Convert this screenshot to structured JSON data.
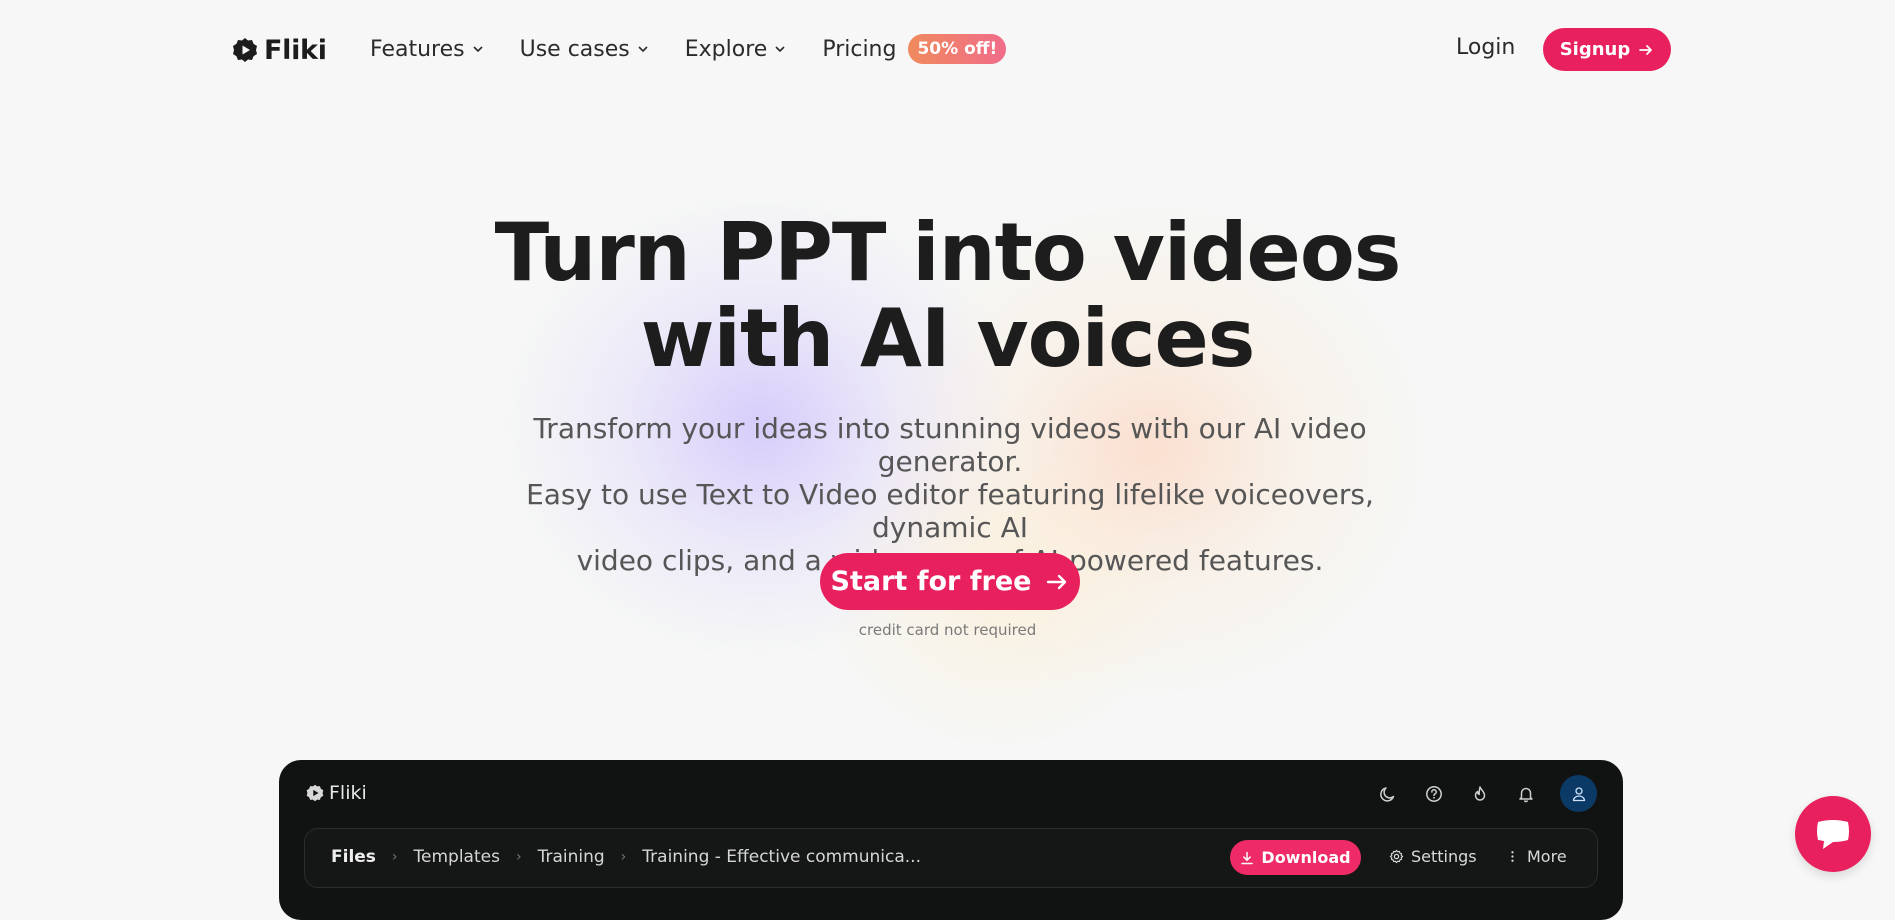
{
  "nav": {
    "logo": "Fliki",
    "items": [
      {
        "label": "Features",
        "icon": "chevron-down-icon"
      },
      {
        "label": "Use cases",
        "icon": "chevron-down-icon"
      },
      {
        "label": "Explore",
        "icon": "chevron-down-icon"
      },
      {
        "label": "Pricing"
      }
    ],
    "pricing_badge": "50% off!",
    "login": "Login",
    "signup": "Signup"
  },
  "hero": {
    "title_line1": "Turn PPT into videos",
    "title_line2": "with AI voices",
    "subtitle_line1": "Transform your ideas into stunning videos with our AI video generator.",
    "subtitle_line2": "Easy to use Text to Video editor featuring lifelike voiceovers, dynamic AI",
    "subtitle_line3": "video clips, and a wide range of AI-powered features.",
    "cta": "Start for free",
    "note": "credit card not required"
  },
  "app_preview": {
    "logo": "Fliki",
    "header_icons": [
      "moon-icon",
      "help-icon",
      "flame-icon",
      "bell-icon",
      "user-icon"
    ],
    "breadcrumbs": [
      "Files",
      "Templates",
      "Training",
      "Training - Effective communica..."
    ],
    "download": "Download",
    "settings": "Settings",
    "more": "More"
  },
  "colors": {
    "accent": "#e8215e",
    "badge_gradient": [
      "#f08a5d",
      "#f06c8a"
    ],
    "app_background": "#111212",
    "avatar": "#0b3a66"
  },
  "chat_widget": {
    "icon": "chat-bubble-icon"
  }
}
